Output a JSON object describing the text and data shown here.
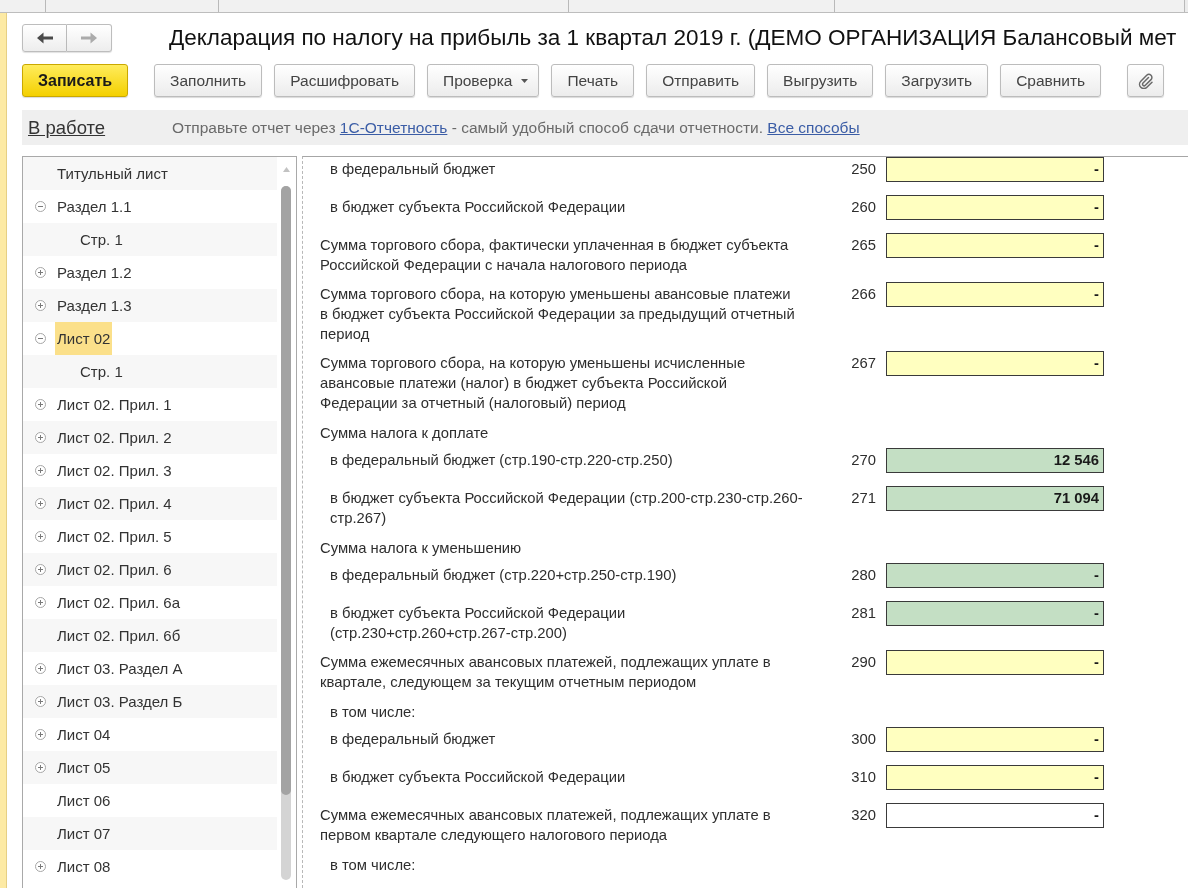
{
  "tab_bar": {
    "tabs": [
      {
        "selected": false
      },
      {
        "selected": false
      },
      {
        "selected": false
      },
      {
        "selected": false
      },
      {
        "selected": false
      }
    ]
  },
  "navigation": [
    {
      "kind": "back",
      "disabled": false
    },
    {
      "kind": "forward",
      "disabled": true
    }
  ],
  "document": {
    "title": "Декларация по налогу на прибыль за 1 квартал 2019 г. (ДЕМО ОРГАНИЗАЦИЯ Балансовый мет"
  },
  "toolbar": {
    "buttons": [
      {
        "kind": "primary",
        "label": "Записать"
      },
      {
        "kind": "normal",
        "label": "Заполнить"
      },
      {
        "kind": "normal",
        "label": "Расшифровать"
      },
      {
        "kind": "dropdown",
        "label": "Проверка"
      },
      {
        "kind": "normal",
        "label": "Печать"
      },
      {
        "kind": "normal",
        "label": "Отправить"
      },
      {
        "kind": "normal",
        "label": "Выгрузить"
      },
      {
        "kind": "normal",
        "label": "Загрузить"
      },
      {
        "kind": "normal",
        "label": "Сравнить"
      },
      {
        "kind": "attach"
      }
    ]
  },
  "info_bar": {
    "status": "В работе",
    "message": [
      {
        "kind": "text",
        "text": "Отправьте отчет через"
      },
      {
        "kind": "link",
        "text": "1С-Отчетность"
      },
      {
        "kind": "text",
        "text": "- самый удобный способ сдачи отчетности."
      },
      {
        "kind": "link",
        "text": "Все способы"
      }
    ]
  },
  "tree": {
    "items": [
      {
        "label": "Титульный лист",
        "kind": "page",
        "selected": false
      },
      {
        "label": "Раздел 1.1",
        "kind": "group",
        "expanded": true,
        "selected": false,
        "children": [
          {
            "label": "Стр. 1",
            "kind": "page",
            "selected": false
          }
        ]
      },
      {
        "label": "Раздел 1.2",
        "kind": "group",
        "expanded": false,
        "selected": false
      },
      {
        "label": "Раздел 1.3",
        "kind": "group",
        "expanded": false,
        "selected": false
      },
      {
        "label": "Лист 02",
        "kind": "group",
        "expanded": true,
        "selected": true,
        "children": [
          {
            "label": "Стр. 1",
            "kind": "page",
            "selected": false
          }
        ]
      },
      {
        "label": "Лист 02. Прил. 1",
        "kind": "group",
        "expanded": false,
        "selected": false
      },
      {
        "label": "Лист 02. Прил. 2",
        "kind": "group",
        "expanded": false,
        "selected": false
      },
      {
        "label": "Лист 02. Прил. 3",
        "kind": "group",
        "expanded": false,
        "selected": false
      },
      {
        "label": "Лист 02. Прил. 4",
        "kind": "group",
        "expanded": false,
        "selected": false
      },
      {
        "label": "Лист 02. Прил. 5",
        "kind": "group",
        "expanded": false,
        "selected": false
      },
      {
        "label": "Лист 02. Прил. 6",
        "kind": "group",
        "expanded": false,
        "selected": false
      },
      {
        "label": "Лист 02. Прил. 6а",
        "kind": "group",
        "expanded": false,
        "selected": false
      },
      {
        "label": "Лист 02. Прил. 6б",
        "kind": "page",
        "selected": false
      },
      {
        "label": "Лист 03. Раздел А",
        "kind": "group",
        "expanded": false,
        "selected": false
      },
      {
        "label": "Лист 03. Раздел Б",
        "kind": "group",
        "expanded": false,
        "selected": false
      },
      {
        "label": "Лист 04",
        "kind": "group",
        "expanded": false,
        "selected": false
      },
      {
        "label": "Лист 05",
        "kind": "group",
        "expanded": false,
        "selected": false
      },
      {
        "label": "Лист 06",
        "kind": "page",
        "selected": false
      },
      {
        "label": "Лист 07",
        "kind": "page",
        "selected": false
      },
      {
        "label": "Лист 08",
        "kind": "group",
        "expanded": false,
        "selected": false
      }
    ]
  },
  "form": {
    "rows": [
      {
        "kind": "subline",
        "label": "в федеральный бюджет",
        "code": "250",
        "value": "-",
        "color": "#ffffc0"
      },
      {
        "kind": "subline",
        "label": "в бюджет субъекта Российской Федерации",
        "code": "260",
        "value": "-",
        "color": "#ffffc0"
      },
      {
        "kind": "line",
        "label": "Сумма торгового сбора, фактически уплаченная в бюджет субъекта\nРоссийской Федерации с начала налогового периода",
        "code": "265",
        "value": "-",
        "color": "#ffffc0"
      },
      {
        "kind": "line",
        "label": "Сумма торгового сбора, на которую уменьшены авансовые платежи\nв бюджет субъекта Российской Федерации за предыдущий отчетный\nпериод",
        "code": "266",
        "value": "-",
        "color": "#ffffc0"
      },
      {
        "kind": "line",
        "label": "Сумма торгового сбора, на которую уменьшены исчисленные\nавансовые платежи (налог) в бюджет субъекта Российской\nФедерации за отчетный (налоговый) период",
        "code": "267",
        "value": "-",
        "color": "#ffffc0"
      },
      {
        "kind": "heading",
        "label": "Сумма налога к доплате"
      },
      {
        "kind": "subline",
        "label": "в федеральный бюджет (стр.190-стр.220-стр.250)",
        "code": "270",
        "value": "12 546",
        "color": "#c4dfc4"
      },
      {
        "kind": "subline",
        "label": "в бюджет субъекта Российской Федерации (стр.200-стр.230-стр.260-\nстр.267)",
        "code": "271",
        "value": "71 094",
        "color": "#c4dfc4"
      },
      {
        "kind": "heading",
        "label": "Сумма налога к уменьшению"
      },
      {
        "kind": "subline",
        "label": "в федеральный бюджет (стр.220+стр.250-стр.190)",
        "code": "280",
        "value": "-",
        "color": "#c4dfc4"
      },
      {
        "kind": "subline",
        "label": "в бюджет субъекта Российской Федерации\n(стр.230+стр.260+стр.267-стр.200)",
        "code": "281",
        "value": "-",
        "color": "#c4dfc4"
      },
      {
        "kind": "line",
        "label": "Сумма ежемесячных авансовых платежей, подлежащих уплате в\nквартале, следующем за текущим отчетным периодом",
        "code": "290",
        "value": "-",
        "color": "#ffffc0"
      },
      {
        "kind": "subheading",
        "label": "в том числе:"
      },
      {
        "kind": "subline",
        "label": "в федеральный бюджет",
        "code": "300",
        "value": "-",
        "color": "#ffffc0"
      },
      {
        "kind": "subline",
        "label": "в бюджет субъекта Российской Федерации",
        "code": "310",
        "value": "-",
        "color": "#ffffc0"
      },
      {
        "kind": "line",
        "label": "Сумма ежемесячных авансовых платежей, подлежащих уплате в\nпервом квартале следующего налогового периода",
        "code": "320",
        "value": "-",
        "color": "#ffffff"
      },
      {
        "kind": "subheading",
        "label": "в том числе:"
      }
    ]
  }
}
